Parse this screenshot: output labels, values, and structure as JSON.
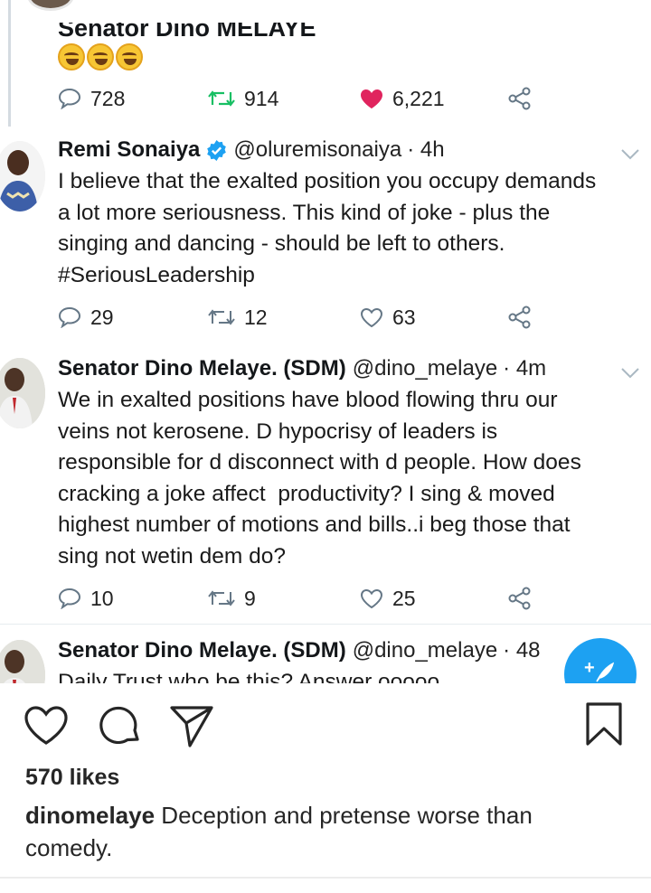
{
  "tweet_top": {
    "name_partial": "Senator Dino MELAYE",
    "emoji": "laughing-tears-emoji",
    "replies": "728",
    "retweets": "914",
    "likes": "6,221",
    "liked": true
  },
  "tweet_remi": {
    "name": "Remi Sonaiya",
    "verified": true,
    "handle": "@oluremisonaiya",
    "time": "· 4h",
    "lines": [
      "I believe that the exalted position you occupy demands",
      "a lot more seriousness. This kind of joke - plus the",
      "singing and dancing - should be left to others.",
      "#SeriousLeadership"
    ],
    "replies": "29",
    "retweets": "12",
    "likes": "63"
  },
  "tweet_dino_reply": {
    "name": "Senator Dino Melaye. (SDM)",
    "handle": "@dino_melaye",
    "time": "· 4m",
    "lines": [
      "We in exalted positions have blood flowing thru our",
      "veins not kerosene. D hypocrisy of leaders is",
      "responsible for d disconnect with d people. How does",
      "cracking a joke affect  productivity? I sing & moved",
      "highest number of motions and bills..i beg those that",
      "sing not wetin dem do?"
    ],
    "replies": "10",
    "retweets": "9",
    "likes": "25"
  },
  "tweet_dino_partial": {
    "name": "Senator Dino Melaye. (SDM)",
    "handle": "@dino_melaye",
    "time": "· 48",
    "line_partial": "Daily Trust who be this? Answer ooooo"
  },
  "colors": {
    "twitter_blue": "#1da1f2",
    "retweet_green": "#17bf63",
    "like_red": "#e0245e",
    "icon_gray": "#657786"
  },
  "instagram": {
    "likes": "570 likes",
    "username": "dinomelaye",
    "caption": "Deception and pretense worse than comedy."
  }
}
